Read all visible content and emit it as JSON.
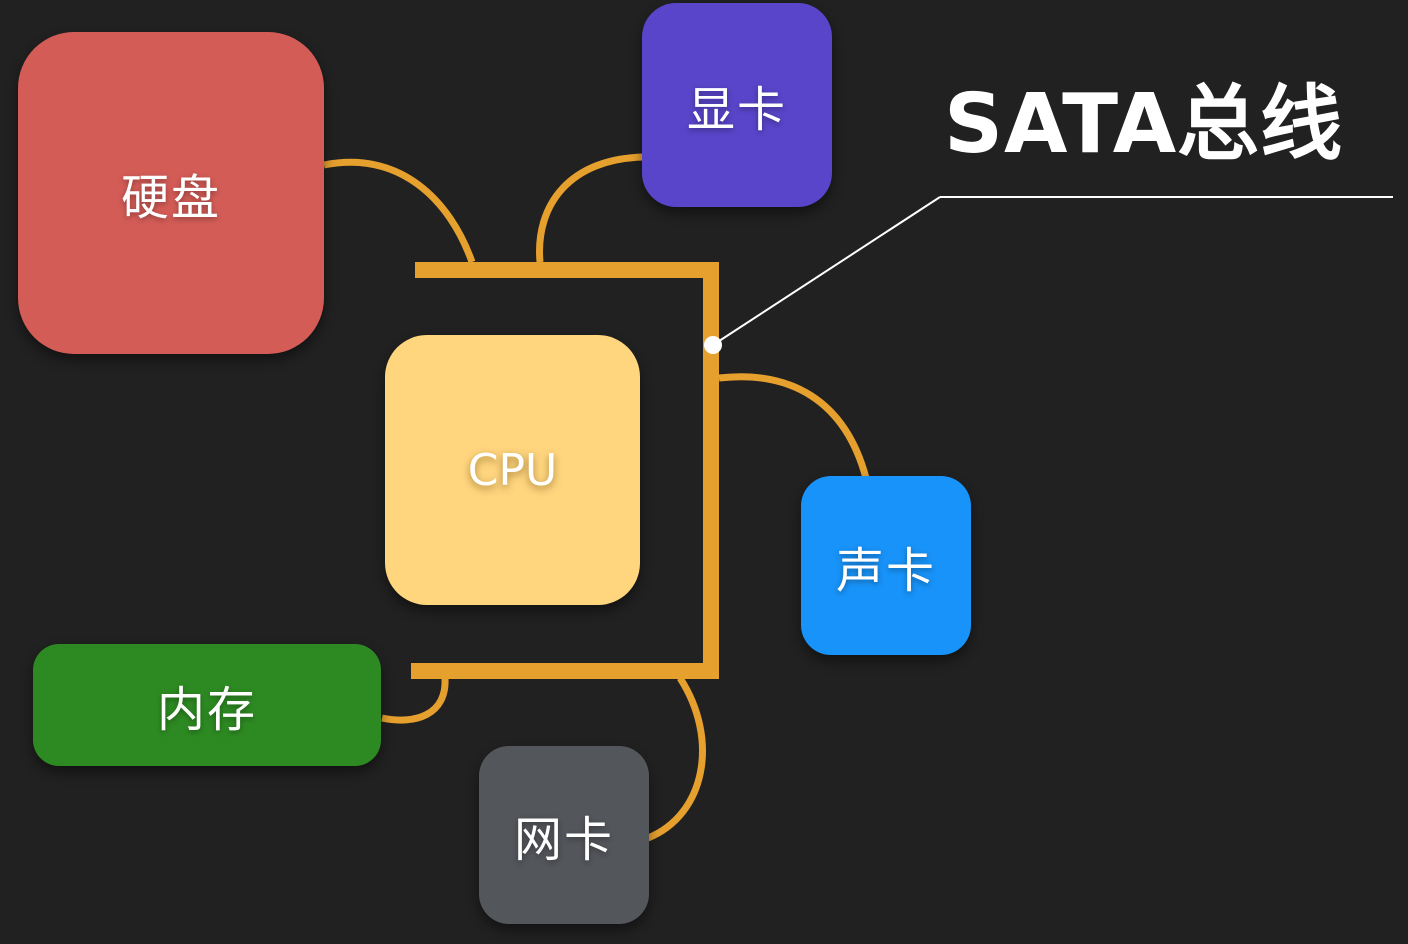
{
  "title": "SATA总线",
  "colors": {
    "background": "#212121",
    "bus": "#E6A02E",
    "callout": "#FFFFFF"
  },
  "components": {
    "hdd": {
      "label": "硬盘",
      "color": "#D45C57"
    },
    "gpu": {
      "label": "显卡",
      "color": "#5845C9"
    },
    "cpu": {
      "label": "CPU",
      "color": "#FFD57E"
    },
    "sound": {
      "label": "声卡",
      "color": "#1893F9"
    },
    "ram": {
      "label": "内存",
      "color": "#2D8A22"
    },
    "nic": {
      "label": "网卡",
      "color": "#53565B"
    }
  }
}
